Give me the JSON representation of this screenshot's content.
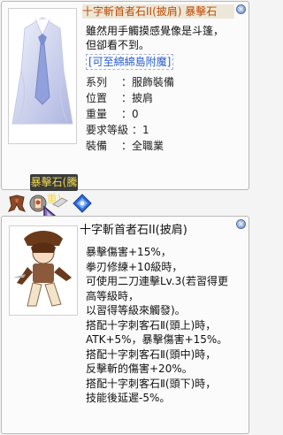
{
  "top_tooltip": {
    "title": "十字斬首者石II(披肩) 暴擊石",
    "description_lines": [
      "雖然用手觸摸感覺像是斗篷，",
      "但卻看不到。"
    ],
    "link_text": "[可至綿綿島附魔]",
    "properties": [
      {
        "key": "系列",
        "value": "服飾裝備"
      },
      {
        "key": "位置",
        "value": "披肩"
      },
      {
        "key": "重量",
        "value": "0"
      },
      {
        "key": "要求等級",
        "value": "1"
      },
      {
        "key": "裝備",
        "value": "全職業"
      }
    ],
    "close_glyph": "×",
    "title_color": "#c04800",
    "link_color": "#2a5fd0"
  },
  "slot_label": "暴擊石(騰重)",
  "bottom_tooltip": {
    "title": "十字斬首者石II(披肩)",
    "description_lines": [
      "暴擊傷害+15%，",
      "拳刃修練+10級時，",
      "可使用二刀連擊Lv.3(若習得更",
      "高等級時，",
      "以習得等級來觸發)。",
      "搭配十字刺客石Ⅱ(頭上)時，",
      "ATK+5%，暴擊傷害+15%。",
      "搭配十字刺客石Ⅱ(頭中)時，",
      "反擊斬的傷害+20%。",
      "搭配十字刺客石Ⅱ(頭下)時，",
      "技能後延遲-5%。"
    ],
    "close_glyph": "×"
  },
  "icons": [
    "scarf-icon",
    "card-icon",
    "blue-gem-icon",
    "mouse-pointer-icon"
  ]
}
